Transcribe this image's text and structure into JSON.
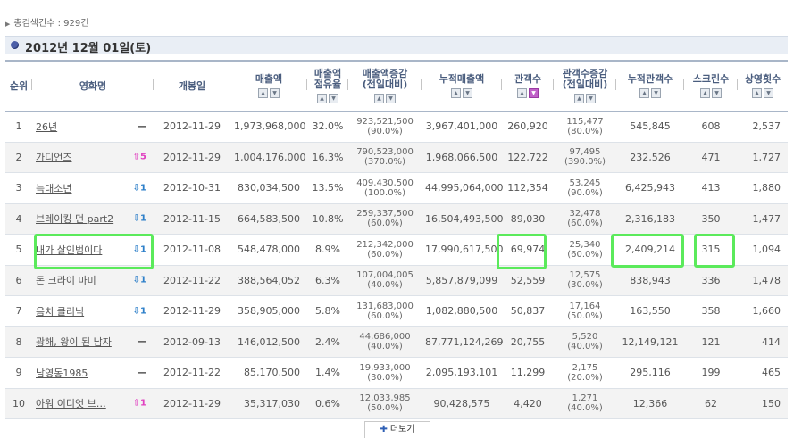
{
  "summary": {
    "text": "총검색건수 : 929건"
  },
  "date_title": "2012년 12월 01일(토)",
  "columns": [
    {
      "key": "rank",
      "label": "순위",
      "sortable": false
    },
    {
      "key": "movie",
      "label": "영화명",
      "sortable": false
    },
    {
      "key": "release",
      "label": "개봉일",
      "sortable": false
    },
    {
      "key": "sales",
      "label": "매출액",
      "sortable": true
    },
    {
      "key": "share",
      "label": "매출액\n점유율",
      "sortable": true
    },
    {
      "key": "sales_change",
      "label": "매출액증감\n(전일대비)",
      "sortable": true
    },
    {
      "key": "cum_sales",
      "label": "누적매출액",
      "sortable": true
    },
    {
      "key": "audience",
      "label": "관객수",
      "sortable": true,
      "active": true
    },
    {
      "key": "aud_change",
      "label": "관객수증감\n(전일대비)",
      "sortable": true
    },
    {
      "key": "cum_aud",
      "label": "누적관객수",
      "sortable": true
    },
    {
      "key": "screens",
      "label": "스크린수",
      "sortable": true
    },
    {
      "key": "shows",
      "label": "상영횟수",
      "sortable": true
    }
  ],
  "rows": [
    {
      "rank": "1",
      "movie": "26년",
      "rank_change": {
        "dir": "same",
        "value": ""
      },
      "release": "2012-11-29",
      "sales": "1,973,968,000",
      "share": "32.0%",
      "sales_change": "923,521,500",
      "sales_change_pct": "(90.0%)",
      "cum_sales": "3,967,401,000",
      "audience": "260,920",
      "aud_change": "115,477",
      "aud_change_pct": "(80.0%)",
      "cum_aud": "545,845",
      "screens": "608",
      "shows": "2,537"
    },
    {
      "rank": "2",
      "movie": "가디언즈",
      "rank_change": {
        "dir": "up",
        "value": "5"
      },
      "release": "2012-11-29",
      "sales": "1,004,176,000",
      "share": "16.3%",
      "sales_change": "790,523,000",
      "sales_change_pct": "(370.0%)",
      "cum_sales": "1,968,066,500",
      "audience": "122,722",
      "aud_change": "97,495",
      "aud_change_pct": "(390.0%)",
      "cum_aud": "232,526",
      "screens": "471",
      "shows": "1,727"
    },
    {
      "rank": "3",
      "movie": "늑대소년",
      "rank_change": {
        "dir": "down",
        "value": "1"
      },
      "release": "2012-10-31",
      "sales": "830,034,500",
      "share": "13.5%",
      "sales_change": "409,430,500",
      "sales_change_pct": "(100.0%)",
      "cum_sales": "44,995,064,000",
      "audience": "112,354",
      "aud_change": "53,245",
      "aud_change_pct": "(90.0%)",
      "cum_aud": "6,425,943",
      "screens": "413",
      "shows": "1,880"
    },
    {
      "rank": "4",
      "movie": "브레이킹 던 part2",
      "rank_change": {
        "dir": "down",
        "value": "1"
      },
      "release": "2012-11-15",
      "sales": "664,583,500",
      "share": "10.8%",
      "sales_change": "259,337,500",
      "sales_change_pct": "(60.0%)",
      "cum_sales": "16,504,493,500",
      "audience": "89,030",
      "aud_change": "32,478",
      "aud_change_pct": "(60.0%)",
      "cum_aud": "2,316,183",
      "screens": "350",
      "shows": "1,477"
    },
    {
      "rank": "5",
      "movie": "내가 살인범이다",
      "rank_change": {
        "dir": "down",
        "value": "1"
      },
      "release": "2012-11-08",
      "sales": "548,478,000",
      "share": "8.9%",
      "sales_change": "212,342,000",
      "sales_change_pct": "(60.0%)",
      "cum_sales": "17,990,617,500",
      "audience": "69,974",
      "aud_change": "25,340",
      "aud_change_pct": "(60.0%)",
      "cum_aud": "2,409,214",
      "screens": "315",
      "shows": "1,094"
    },
    {
      "rank": "6",
      "movie": "돈 크라이 마미",
      "rank_change": {
        "dir": "down",
        "value": "1"
      },
      "release": "2012-11-22",
      "sales": "388,564,052",
      "share": "6.3%",
      "sales_change": "107,004,005",
      "sales_change_pct": "(40.0%)",
      "cum_sales": "5,857,879,099",
      "audience": "52,559",
      "aud_change": "12,575",
      "aud_change_pct": "(30.0%)",
      "cum_aud": "838,943",
      "screens": "336",
      "shows": "1,478"
    },
    {
      "rank": "7",
      "movie": "음치 클리닉",
      "rank_change": {
        "dir": "down",
        "value": "1"
      },
      "release": "2012-11-29",
      "sales": "358,905,000",
      "share": "5.8%",
      "sales_change": "131,683,000",
      "sales_change_pct": "(60.0%)",
      "cum_sales": "1,082,880,500",
      "audience": "50,837",
      "aud_change": "17,164",
      "aud_change_pct": "(50.0%)",
      "cum_aud": "163,550",
      "screens": "358",
      "shows": "1,660"
    },
    {
      "rank": "8",
      "movie": "광해, 왕이 된 남자",
      "rank_change": {
        "dir": "same",
        "value": ""
      },
      "release": "2012-09-13",
      "sales": "146,012,500",
      "share": "2.4%",
      "sales_change": "44,686,000",
      "sales_change_pct": "(40.0%)",
      "cum_sales": "87,771,124,269",
      "audience": "20,755",
      "aud_change": "5,520",
      "aud_change_pct": "(40.0%)",
      "cum_aud": "12,149,121",
      "screens": "121",
      "shows": "414"
    },
    {
      "rank": "9",
      "movie": "남영동1985",
      "rank_change": {
        "dir": "same",
        "value": ""
      },
      "release": "2012-11-22",
      "sales": "85,170,500",
      "share": "1.4%",
      "sales_change": "19,933,000",
      "sales_change_pct": "(30.0%)",
      "cum_sales": "2,095,193,101",
      "audience": "11,299",
      "aud_change": "2,175",
      "aud_change_pct": "(20.0%)",
      "cum_aud": "295,116",
      "screens": "199",
      "shows": "465"
    },
    {
      "rank": "10",
      "movie": "아워 이디엇 브…",
      "rank_change": {
        "dir": "up",
        "value": "1"
      },
      "release": "2012-11-29",
      "sales": "35,317,030",
      "share": "0.6%",
      "sales_change": "12,033,985",
      "sales_change_pct": "(50.0%)",
      "cum_sales": "90,428,575",
      "audience": "4,420",
      "aud_change": "1,271",
      "aud_change_pct": "(40.0%)",
      "cum_aud": "12,366",
      "screens": "62",
      "shows": "150"
    }
  ],
  "more_button": "더보기",
  "highlight_color": "#5bea5b",
  "icons": {
    "up": "up-arrow-icon",
    "down": "down-arrow-icon",
    "same": "dash-icon"
  }
}
